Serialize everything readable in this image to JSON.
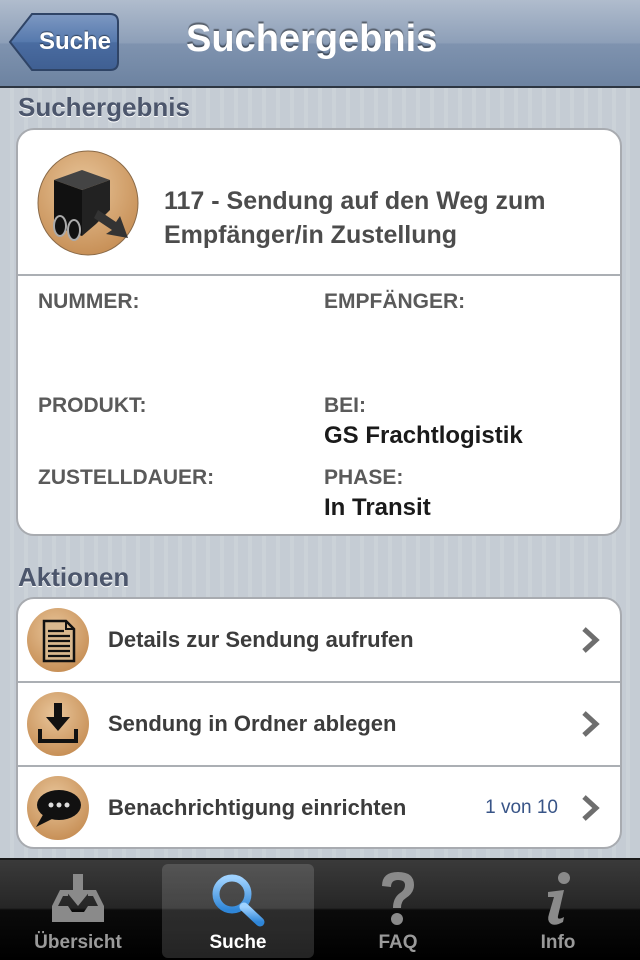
{
  "navbar": {
    "back_label": "Suche",
    "title": "Suchergebnis"
  },
  "result_section": {
    "header": "Suchergebnis",
    "icon": "delivery-truck-icon",
    "status_title": "117 - Sendung auf den Weg zum Empfänger/in Zustellung",
    "fields": {
      "nummer": {
        "label": "NUMMER:",
        "value": ""
      },
      "empfaenger": {
        "label": "EMPFÄNGER:",
        "value": ""
      },
      "produkt": {
        "label": "PRODUKT:",
        "value": ""
      },
      "bei": {
        "label": "BEI:",
        "value": "GS Frachtlogistik"
      },
      "zustelldauer": {
        "label": "ZUSTELLDAUER:",
        "value": ""
      },
      "phase": {
        "label": "PHASE:",
        "value": "In Transit"
      }
    }
  },
  "actions_section": {
    "header": "Aktionen",
    "items": [
      {
        "label": "Details zur Sendung aufrufen",
        "icon": "document-icon",
        "count": ""
      },
      {
        "label": "Sendung in Ordner ablegen",
        "icon": "download-tray-icon",
        "count": ""
      },
      {
        "label": "Benachrichtigung einrichten",
        "icon": "speech-bubble-icon",
        "count": "1 von 10"
      }
    ]
  },
  "tabbar": {
    "tabs": [
      {
        "label": "Übersicht",
        "icon": "inbox-download-icon",
        "active": false
      },
      {
        "label": "Suche",
        "icon": "magnifier-icon",
        "active": true
      },
      {
        "label": "FAQ",
        "icon": "question-mark-icon",
        "active": false
      },
      {
        "label": "Info",
        "icon": "info-icon",
        "active": false
      }
    ]
  },
  "colors": {
    "nav_blue": "#6d83a1",
    "back_button": "#4a6a9a",
    "icon_circle": "#d3a26e",
    "count_text": "#385487",
    "active_tab_icon": "#3f9ae8"
  }
}
